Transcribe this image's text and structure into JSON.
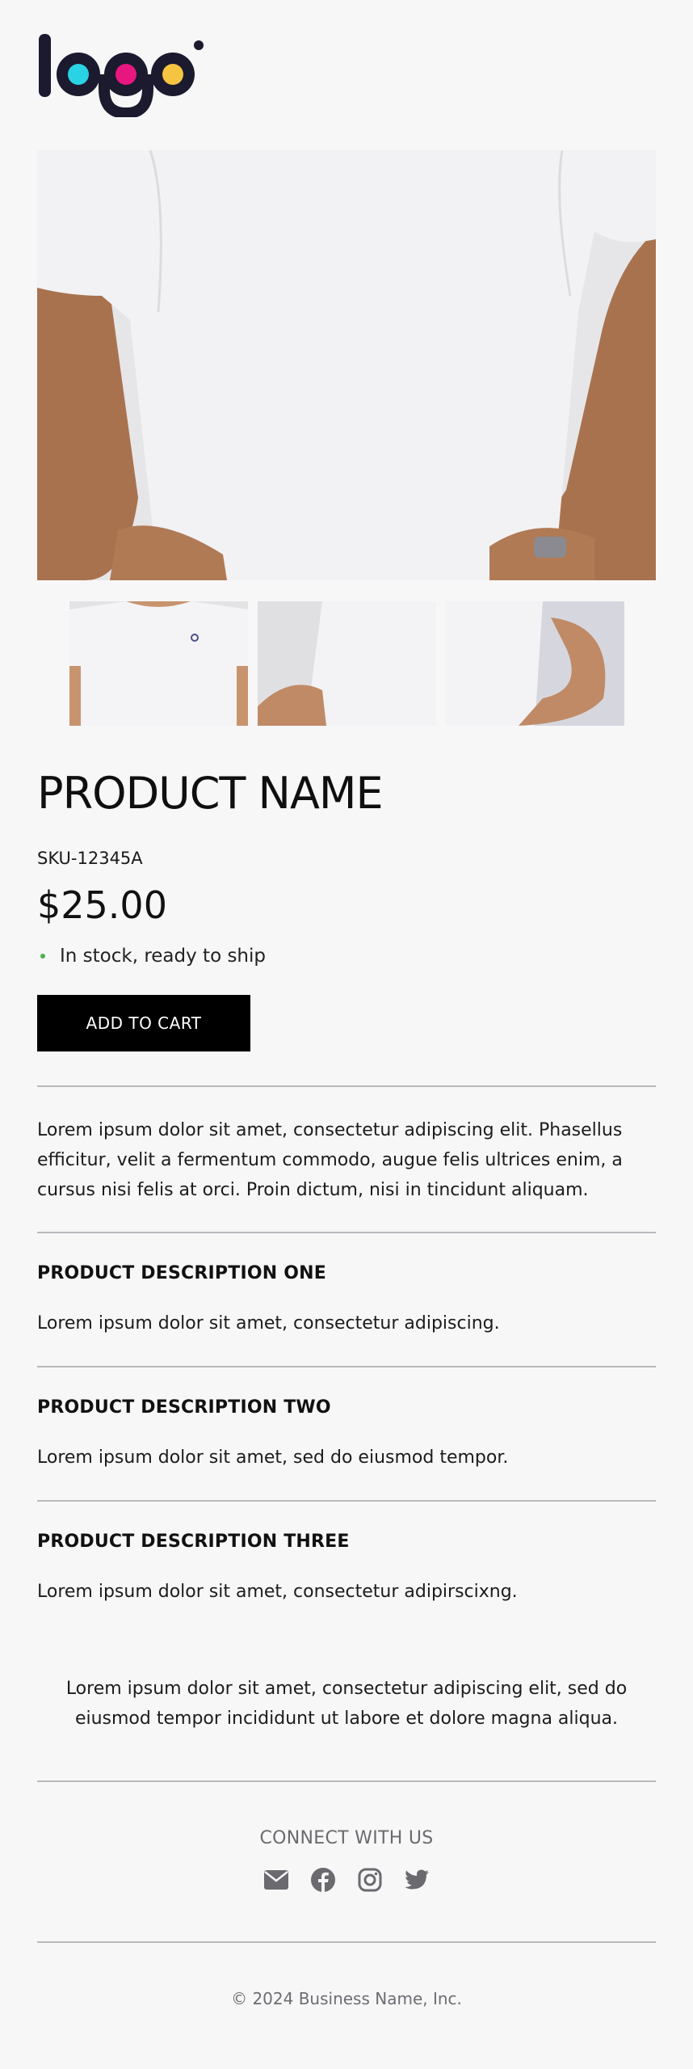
{
  "brand": {
    "logo_text": "logo"
  },
  "product": {
    "title": "PRODUCT NAME",
    "sku": "SKU-12345A",
    "price": "$25.00",
    "stock_text": "In stock, ready to ship",
    "add_to_cart_label": "ADD TO CART",
    "intro": "Lorem ipsum dolor sit amet, consectetur adipiscing elit. Phasellus efficitur, velit a fermentum commodo, augue felis ultrices enim, a cursus nisi felis at orci. Proin dictum, nisi in tincidunt aliquam."
  },
  "sections": [
    {
      "heading": "PRODUCT DESCRIPTION ONE",
      "body": "Lorem ipsum dolor sit amet, consectetur adipiscing."
    },
    {
      "heading": "PRODUCT DESCRIPTION TWO",
      "body": "Lorem ipsum dolor sit amet, sed do eiusmod tempor."
    },
    {
      "heading": "PRODUCT DESCRIPTION THREE",
      "body": "Lorem ipsum dolor sit amet, consectetur adipirscixng."
    }
  ],
  "footer": {
    "blurb": "Lorem ipsum dolor sit amet, consectetur adipiscing elit, sed do eiusmod tempor incididunt ut labore et dolore magna aliqua.",
    "connect_label": "CONNECT WITH US",
    "social_icons": [
      "email-icon",
      "facebook-icon",
      "instagram-icon",
      "twitter-icon"
    ],
    "copyright": "© 2024 Business Name, Inc."
  },
  "colors": {
    "background": "#f7f7f8",
    "button": "#000000",
    "stock_dot": "#4caf50",
    "logo_dot_1": "#29d3e3",
    "logo_dot_2": "#e8177f",
    "logo_dot_3": "#f5c542"
  }
}
